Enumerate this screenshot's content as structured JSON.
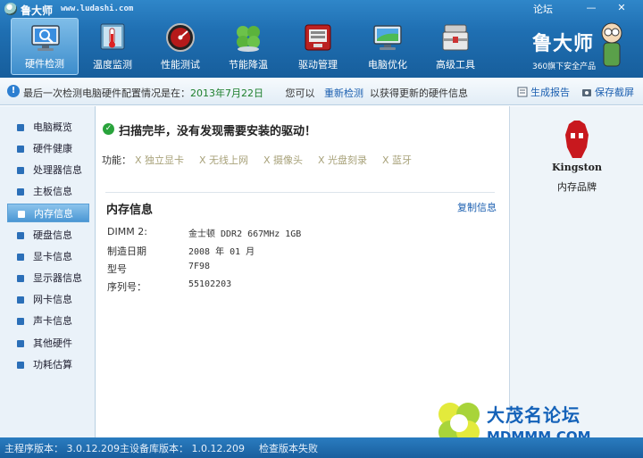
{
  "titlebar": {
    "title": "鲁大师",
    "url": "www.ludashi.com",
    "forum": "论坛",
    "minimize": "—",
    "close": "✕"
  },
  "toolbar": {
    "tabs": [
      {
        "label": "硬件检测",
        "icon": "monitor-magnifier-icon",
        "active": true
      },
      {
        "label": "温度监测",
        "icon": "thermometer-icon",
        "active": false
      },
      {
        "label": "性能测试",
        "icon": "speedometer-icon",
        "active": false
      },
      {
        "label": "节能降温",
        "icon": "clover-icon",
        "active": false
      },
      {
        "label": "驱动管理",
        "icon": "toolbox-icon",
        "active": false
      },
      {
        "label": "电脑优化",
        "icon": "broom-monitor-icon",
        "active": false
      },
      {
        "label": "高级工具",
        "icon": "tools-case-icon",
        "active": false
      }
    ],
    "brand_name": "鲁大师",
    "brand_sub": "360旗下安全产品"
  },
  "infobar": {
    "prefix": "最后一次检测电脑硬件配置情况是在：",
    "date": "2013年7月22日",
    "middle": "您可以",
    "rescan": "重新检测",
    "suffix": "以获得更新的硬件信息",
    "report": "生成报告",
    "screenshot": "保存截屏"
  },
  "sidebar": {
    "items": [
      {
        "label": "电脑概览",
        "active": false
      },
      {
        "label": "硬件健康",
        "active": false
      },
      {
        "label": "处理器信息",
        "active": false
      },
      {
        "label": "主板信息",
        "active": false
      },
      {
        "label": "内存信息",
        "active": true
      },
      {
        "label": "硬盘信息",
        "active": false
      },
      {
        "label": "显卡信息",
        "active": false
      },
      {
        "label": "显示器信息",
        "active": false
      },
      {
        "label": "网卡信息",
        "active": false
      },
      {
        "label": "声卡信息",
        "active": false
      },
      {
        "label": "其他硬件",
        "active": false
      },
      {
        "label": "功耗估算",
        "active": false
      }
    ]
  },
  "main": {
    "status": "扫描完毕，没有发现需要安装的驱动！",
    "func_label": "功能：",
    "features": [
      "X 独立显卡",
      "X 无线上网",
      "X 摄像头",
      "X 光盘刻录",
      "X 蓝牙"
    ],
    "section_title": "内存信息",
    "copy": "复制信息",
    "rows": [
      {
        "key": "DIMM 2:",
        "value": "金士顿 DDR2 667MHz 1GB"
      },
      {
        "key": "制造日期",
        "value": "2008 年 01 月"
      },
      {
        "key": "型号",
        "value": "7F98"
      },
      {
        "key": "序列号：",
        "value": "55102203"
      }
    ]
  },
  "right": {
    "logo_word": "Kingston",
    "caption": "内存品牌"
  },
  "watermark": {
    "title": "大茂名论坛",
    "url": "MDMMM.COM"
  },
  "statusbar": {
    "main_version": "主程序版本：  3.0.12.209",
    "db_version": "主设备库版本：  1.0.12.209",
    "check": "检查版本失败"
  }
}
